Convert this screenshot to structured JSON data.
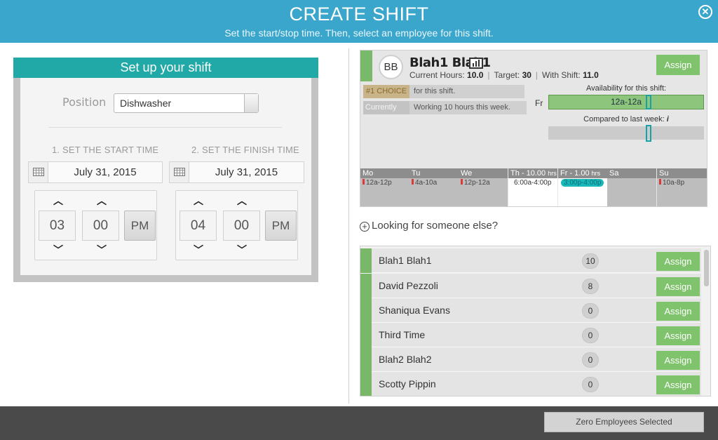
{
  "header": {
    "title": "CREATE SHIFT",
    "subtitle": "Set the start/stop time.  Then, select an employee for this shift.",
    "close_icon": "close-circle-icon"
  },
  "setup": {
    "title": "Set up your shift",
    "position_label": "Position",
    "position_value": "Dishwasher",
    "start": {
      "label": "1. SET THE START TIME",
      "date": "July 31, 2015",
      "hour": "03",
      "minute": "00",
      "ampm": "PM"
    },
    "finish": {
      "label": "2. SET THE FINISH TIME",
      "date": "July 31, 2015",
      "hour": "04",
      "minute": "00",
      "ampm": "PM"
    }
  },
  "selected_employee": {
    "initials": "BB",
    "name": "Blah1 Blah1",
    "current_hours_label": "Current Hours:",
    "current_hours": "10.0",
    "target_label": "Target:",
    "target": "30",
    "with_shift_label": "With Shift:",
    "with_shift": "11.0",
    "assign_label": "Assign",
    "choice_tag": "#1 CHOICE",
    "choice_text": "for this shift.",
    "currently_tag": "Currently",
    "currently_text": "Working 10 hours this week.",
    "availability_label": "Availability for this shift:",
    "availability_day": "Fr",
    "availability_range": "12a-12a",
    "compared_label": "Compared to last week:",
    "info_icon": "i",
    "week": [
      {
        "day": "Mo",
        "extra": "",
        "shift": "12a-12p",
        "unavailable": true
      },
      {
        "day": "Tu",
        "extra": "",
        "shift": "4a-10a",
        "unavailable": true
      },
      {
        "day": "We",
        "extra": "",
        "shift": "12p-12a",
        "unavailable": true
      },
      {
        "day": "Th - 10.00",
        "extra": "hrs",
        "shift": "6:00a-4:00p",
        "unavailable": false
      },
      {
        "day": "Fr   - 1.00",
        "extra": "hrs",
        "shift": "3:00p-4:00p",
        "unavailable": false
      },
      {
        "day": "Sa",
        "extra": "",
        "shift": "",
        "unavailable": false
      },
      {
        "day": "Su",
        "extra": "",
        "shift": "10a-8p",
        "unavailable": true
      }
    ]
  },
  "looking_label": "Looking for someone else?",
  "employees": [
    {
      "name": "Blah1 Blah1",
      "count": "10",
      "assign": "Assign"
    },
    {
      "name": "David Pezzoli",
      "count": "8",
      "assign": "Assign"
    },
    {
      "name": "Shaniqua Evans",
      "count": "0",
      "assign": "Assign"
    },
    {
      "name": "Third Time",
      "count": "0",
      "assign": "Assign"
    },
    {
      "name": "Blah2 Blah2",
      "count": "0",
      "assign": "Assign"
    },
    {
      "name": "Scotty Pippin",
      "count": "0",
      "assign": "Assign"
    }
  ],
  "footer": {
    "selected_label": "Zero Employees Selected"
  },
  "colors": {
    "header": "#3aa6cc",
    "panel_title": "#20a9a6",
    "assign": "#7fc36c",
    "availability": "#8cc57b",
    "footer": "#4a4a4a"
  }
}
